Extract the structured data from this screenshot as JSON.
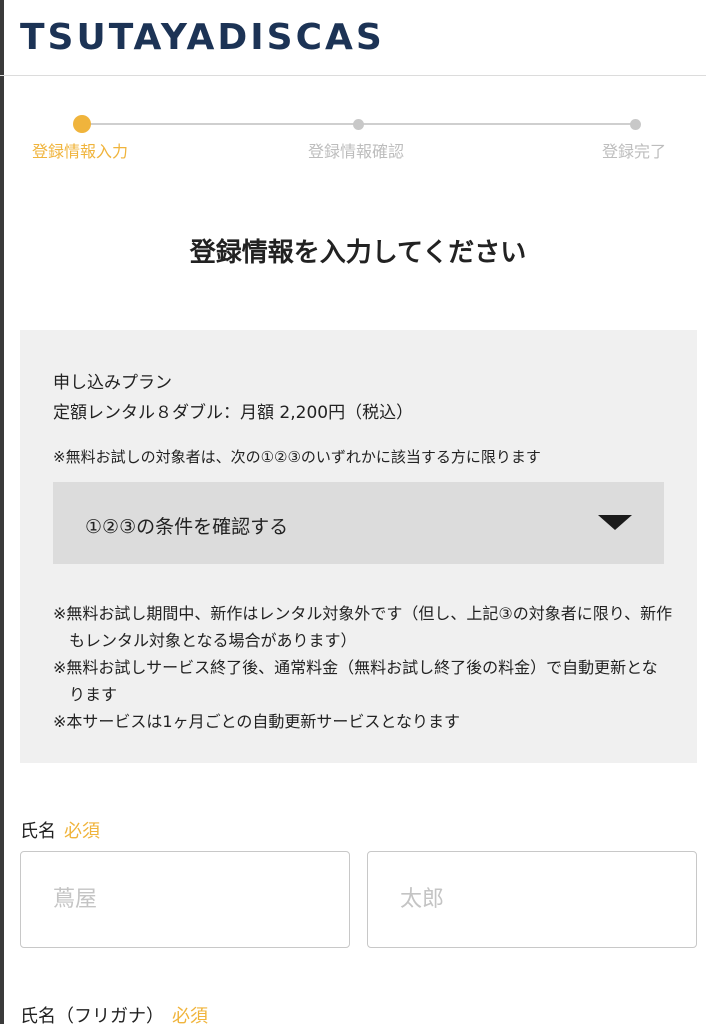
{
  "header": {
    "logo_text": "TSUTAYADISCAS"
  },
  "stepper": {
    "steps": [
      {
        "label": "登録情報入力"
      },
      {
        "label": "登録情報確認"
      },
      {
        "label": "登録完了"
      }
    ],
    "colors": {
      "active": "#f0b43c",
      "inactive": "#c8c8c8"
    }
  },
  "page": {
    "title": "登録情報を入力してください"
  },
  "plan": {
    "label": "申し込みプラン",
    "name": "定額レンタル８ダブル：月額 2,200円（税込）",
    "eligibility_note": "※無料お試しの対象者は、次の①②③のいずれかに該当する方に限ります",
    "accordion_label": "①②③の条件を確認する",
    "accordion_icon": "triangle-down-icon",
    "notes": [
      "※無料お試し期間中、新作はレンタル対象外です（但し、上記③の対象者に限り、新作もレンタル対象となる場合があります）",
      "※無料お試しサービス終了後、通常料金（無料お試し終了後の料金）で自動更新となります",
      "※本サービスは1ヶ月ごとの自動更新サービスとなります"
    ]
  },
  "form": {
    "name": {
      "label": "氏名",
      "required": "必須",
      "last_placeholder": "蔦屋",
      "first_placeholder": "太郎",
      "last_value": "",
      "first_value": ""
    },
    "kana": {
      "label": "氏名（フリガナ）",
      "required": "必須"
    }
  }
}
